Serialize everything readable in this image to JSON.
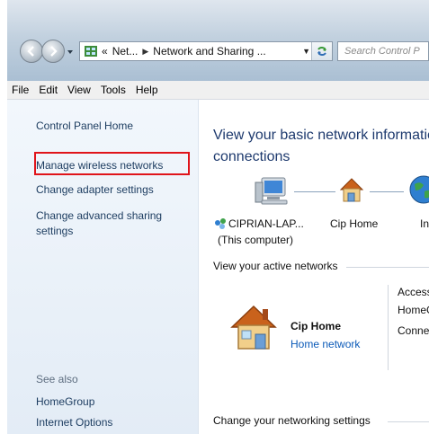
{
  "address_bar": {
    "crumbs": [
      "Net...",
      "Network and Sharing ..."
    ],
    "overflow_chevron": "«"
  },
  "search": {
    "placeholder": "Search Control P"
  },
  "menu": [
    "File",
    "Edit",
    "View",
    "Tools",
    "Help"
  ],
  "sidebar": {
    "home": "Control Panel Home",
    "tasks": [
      "Manage wireless networks",
      "Change adapter settings",
      "Change advanced sharing",
      "settings"
    ],
    "see_also_heading": "See also",
    "see_also": [
      "HomeGroup",
      "Internet Options"
    ],
    "highlighted_item": "Manage wireless networks",
    "highlight_color": "#e0141a"
  },
  "main": {
    "title_line1": "View your basic network informatic",
    "title_line2": "connections",
    "map": {
      "computer_name": "CIPRIAN-LAP...",
      "computer_sub": "(This computer)",
      "network_name": "Cip Home",
      "internet_label": "Int"
    },
    "active_networks_heading": "View your active networks",
    "active_network": {
      "name": "Cip Home",
      "type": "Home network"
    },
    "access_column": [
      "Access",
      "HomeG",
      "Connec"
    ],
    "change_settings_heading": "Change your networking settings"
  },
  "colors": {
    "link": "#1b3b5f",
    "title": "#1e3a6e",
    "network_type_link": "#0b5ab8",
    "sidebar_bg": "#eaf1f8"
  }
}
